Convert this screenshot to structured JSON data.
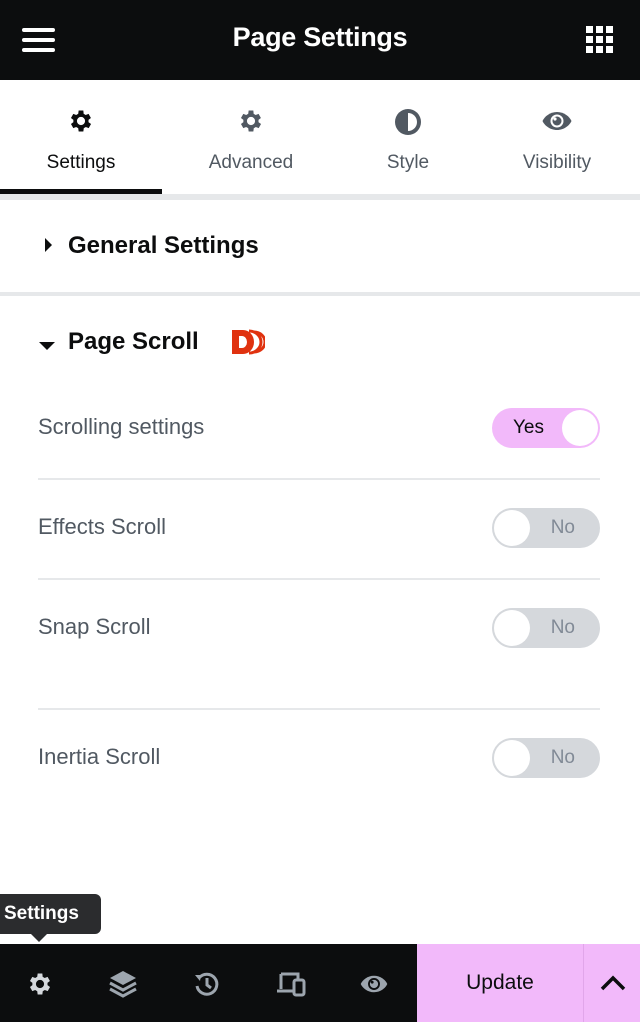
{
  "header": {
    "title": "Page Settings",
    "menu_icon": "hamburger-icon",
    "apps_icon": "grid-icon"
  },
  "tabs": [
    {
      "label": "Settings",
      "icon": "gear-icon",
      "active": true
    },
    {
      "label": "Advanced",
      "icon": "gear-icon",
      "active": false
    },
    {
      "label": "Style",
      "icon": "half-circle-icon",
      "active": false
    },
    {
      "label": "Visibility",
      "icon": "eye-icon",
      "active": false
    }
  ],
  "sections": {
    "general": {
      "title": "General Settings",
      "expanded": false
    },
    "page_scroll": {
      "title": "Page Scroll",
      "expanded": true,
      "badge_icon": "dd-logo-icon",
      "rows": [
        {
          "label": "Scrolling settings",
          "value": "Yes",
          "on": true
        },
        {
          "label": "Effects Scroll",
          "value": "No",
          "on": false
        },
        {
          "label": "Snap Scroll",
          "value": "No",
          "on": false
        },
        {
          "label": "Inertia Scroll",
          "value": "No",
          "on": false
        }
      ]
    }
  },
  "tooltip": {
    "text": "Settings"
  },
  "footer": {
    "icons": [
      "gear-icon",
      "layers-icon",
      "history-icon",
      "responsive-icon",
      "eye-icon"
    ],
    "update_label": "Update",
    "more_icon": "chevron-up-icon"
  },
  "colors": {
    "accent": "#f2b9fa",
    "dark": "#0c0d0e",
    "brand_logo": "#e0320f"
  }
}
